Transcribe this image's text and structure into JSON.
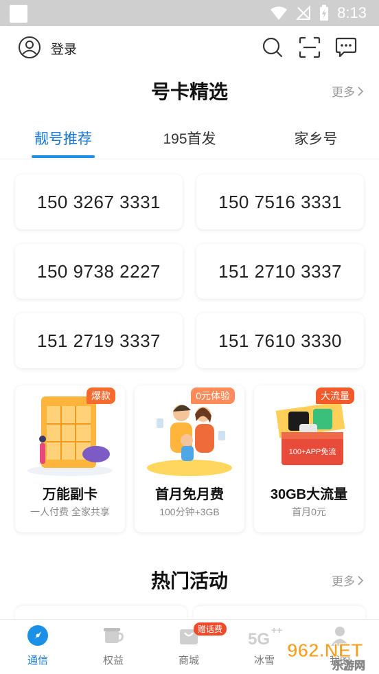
{
  "status_bar": {
    "time": "8:13"
  },
  "header": {
    "login_label": "登录",
    "icons": [
      "user-icon",
      "search-icon",
      "scan-icon",
      "message-icon"
    ]
  },
  "section1": {
    "title": "号卡精选",
    "more_label": "更多",
    "tabs": [
      {
        "label": "靓号推荐",
        "active": true
      },
      {
        "label": "195首发",
        "active": false
      },
      {
        "label": "家乡号",
        "active": false
      }
    ],
    "numbers": [
      "150 3267 3331",
      "150 7516 3331",
      "150 9738 2227",
      "151 2710 3337",
      "151 2719 3337",
      "151 7610 3330"
    ]
  },
  "promos": [
    {
      "badge": "爆款",
      "title": "万能副卡",
      "subtitle": "一人付费 全家共享"
    },
    {
      "badge": "0元体验",
      "title": "首月免月费",
      "subtitle": "100分钟+3GB"
    },
    {
      "badge": "大流量",
      "title": "30GB大流量",
      "subtitle": "首月0元",
      "art_text": "100+APP免流"
    }
  ],
  "section2": {
    "title": "热门活动",
    "more_label": "更多"
  },
  "bottom_nav": [
    {
      "label": "通信",
      "active": true,
      "icon": "phone-compass-icon"
    },
    {
      "label": "权益",
      "active": false,
      "icon": "cup-icon"
    },
    {
      "label": "商城",
      "active": false,
      "icon": "shop-icon",
      "badge": "赠话费"
    },
    {
      "label": "冰雪",
      "active": false,
      "icon": "5g-icon"
    },
    {
      "label": "我的",
      "active": false,
      "icon": "profile-icon"
    }
  ],
  "watermark": {
    "text": "962.NET",
    "subtext": "乐游网"
  },
  "colors": {
    "accent": "#1677d9",
    "badge_orange": "#f56a2d",
    "status_bar": "#cfcfcf"
  }
}
